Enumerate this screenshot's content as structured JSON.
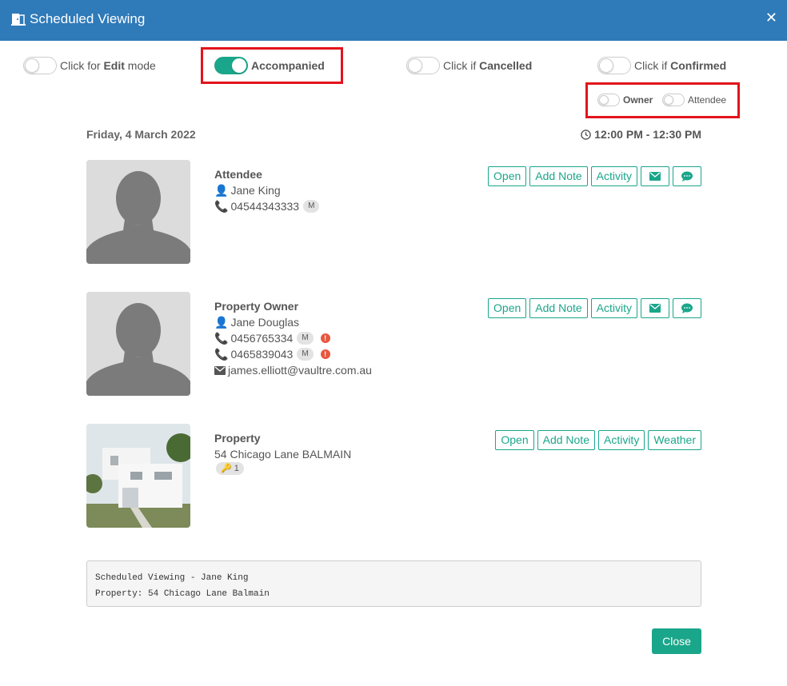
{
  "dialog": {
    "title": "Scheduled Viewing",
    "header_color": "#2f7ab9"
  },
  "toggles": {
    "edit": {
      "prefix": "Click for ",
      "bold": "Edit",
      "suffix": " mode",
      "on": false
    },
    "accompanied": {
      "label": "Accompanied",
      "on": true
    },
    "cancelled": {
      "prefix": "Click if ",
      "bold": "Cancelled",
      "on": false
    },
    "confirmed": {
      "prefix": "Click if ",
      "bold": "Confirmed",
      "on": false
    },
    "owner": {
      "label": "Owner",
      "on": false
    },
    "attendee": {
      "label": "Attendee",
      "on": false
    }
  },
  "schedule": {
    "date": "Friday, 4 March 2022",
    "time": "12:00 PM - 12:30 PM"
  },
  "attendee": {
    "heading": "Attendee",
    "name": "Jane King",
    "phone": "04544343333",
    "phone_badge": "M",
    "buttons": {
      "open": "Open",
      "add_note": "Add Note",
      "activity": "Activity"
    }
  },
  "owner": {
    "heading": "Property Owner",
    "name": "Jane Douglas",
    "phone1": "0456765334",
    "phone1_badge": "M",
    "phone2": "0465839043",
    "phone2_badge": "M",
    "email": "james.elliott@vaultre.com.au",
    "buttons": {
      "open": "Open",
      "add_note": "Add Note",
      "activity": "Activity"
    }
  },
  "property": {
    "heading": "Property",
    "address": "54 Chicago Lane BALMAIN",
    "key_count": "1",
    "buttons": {
      "open": "Open",
      "add_note": "Add Note",
      "activity": "Activity",
      "weather": "Weather"
    }
  },
  "notes": {
    "line1": "Scheduled Viewing - Jane King",
    "line2": "Property: 54 Chicago Lane Balmain"
  },
  "footer": {
    "close_label": "Close"
  },
  "colors": {
    "accent": "#1aa68a",
    "highlight": "#e2141c",
    "warning": "#e8573f"
  }
}
